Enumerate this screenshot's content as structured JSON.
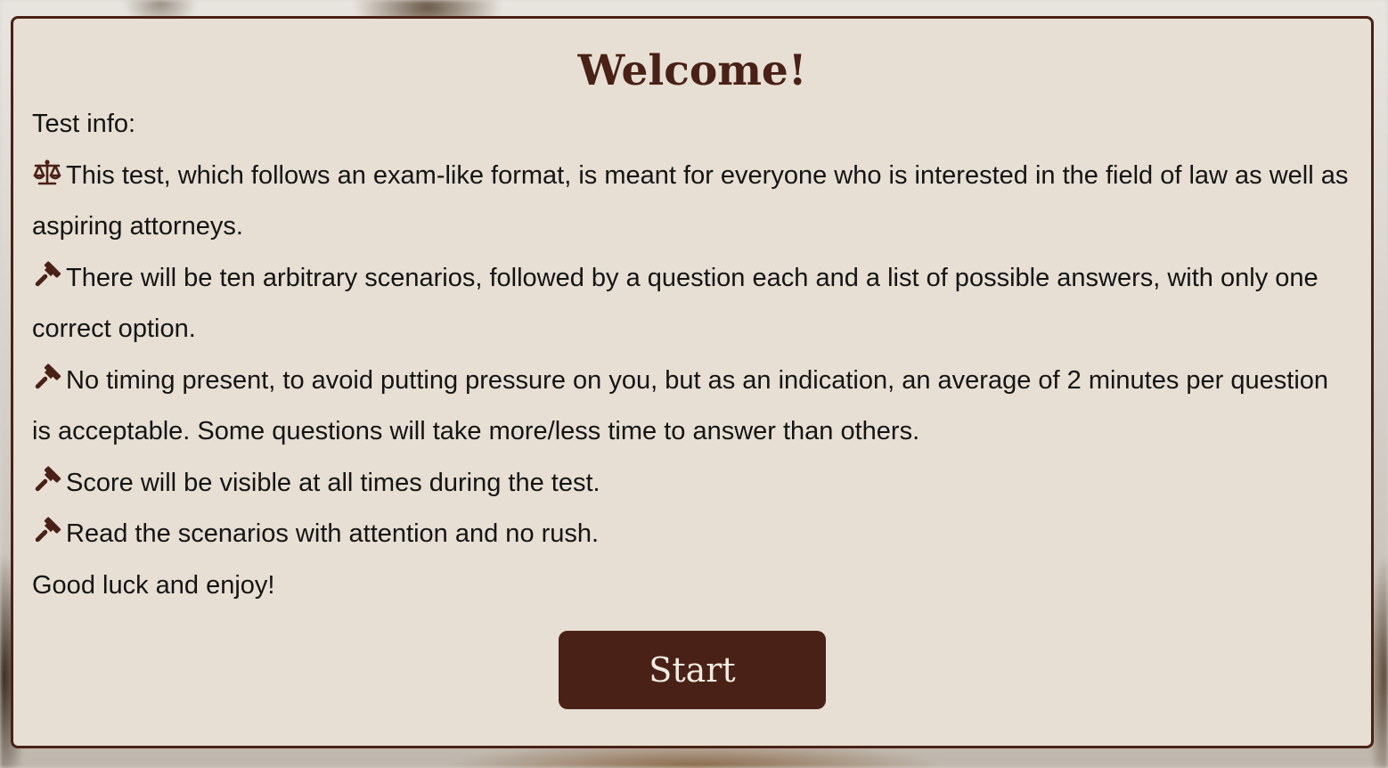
{
  "welcome": {
    "title": "Welcome!",
    "info_label": "Test info:",
    "items": [
      {
        "icon": "scale-icon",
        "text": "This test, which follows an exam-like format, is meant for everyone who is interested in the field of law as well as aspiring attorneys."
      },
      {
        "icon": "gavel-icon",
        "text": "There will be ten arbitrary scenarios, followed by a question each and a list of possible answers, with only one correct option."
      },
      {
        "icon": "gavel-icon",
        "text": "No timing present, to avoid putting pressure on you, but as an indication, an average of 2 minutes per question is acceptable. Some questions will take more/less time to answer than others."
      },
      {
        "icon": "gavel-icon",
        "text": "Score will be visible at all times during the test."
      },
      {
        "icon": "gavel-icon",
        "text": "Read the scenarios with attention and no rush."
      }
    ],
    "closing": "Good luck and enjoy!",
    "start_label": "Start"
  },
  "colors": {
    "accent": "#4a2116",
    "card_background": "#e7dfd3",
    "text": "#141414",
    "button_text": "#f3ece2"
  }
}
